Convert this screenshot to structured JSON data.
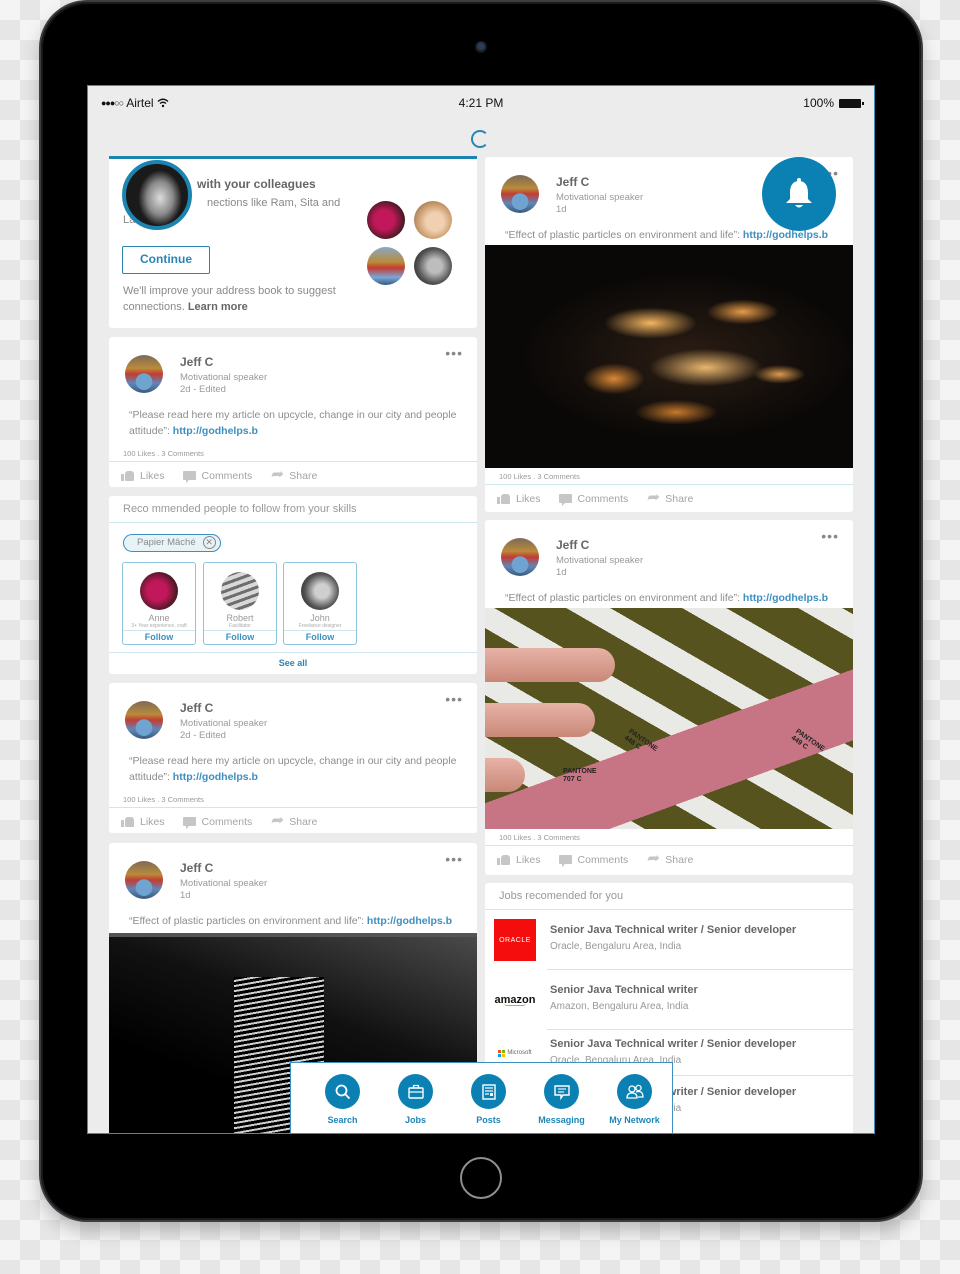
{
  "status_bar": {
    "carrier": "Airtel",
    "time": "4:21 PM",
    "battery": "100%"
  },
  "colors": {
    "accent": "#0b80b3",
    "link": "#3c8fc0",
    "background": "#ececec"
  },
  "connect_card": {
    "title": "Connect with your colleagues",
    "title_visible": "with your colleagues",
    "subtitle": "Find connections like Ram, Sita and La...",
    "subtitle_visible": "nections like Ram, Sita and La",
    "button_label": "Continue",
    "note": "We'll improve your address book to suggest connections.",
    "learn_more": "Learn more"
  },
  "people_card": {
    "header": "Jobs recomended for you / Recommended people to follow from your skills",
    "header_visible": "Reco mmended people to follow from your skills",
    "chip_label": "Papier Mâché",
    "people": [
      {
        "name": "Anne",
        "role": "3+ Year experience, craft",
        "follow": "Follow"
      },
      {
        "name": "Robert",
        "role": "Facilitator",
        "follow": "Follow"
      },
      {
        "name": "John",
        "role": "Freelance designer",
        "follow": "Follow"
      }
    ],
    "see_all": "See all"
  },
  "posts": [
    {
      "name": "Jeff C",
      "title": "Motivational speaker",
      "time": "2d - Edited",
      "text": "“Please read here my article on upcycle, change in our city and people attitude”: ",
      "link": "http://godhelps.b",
      "stats": "100  Likes . 3 Comments"
    },
    {
      "name": "Jeff C",
      "title": "Motivational speaker",
      "time": "2d - Edited",
      "text": "“Please read here my article on upcycle, change in our city and people attitude”: ",
      "link": "http://godhelps.b",
      "stats": "100  Likes . 3 Comments"
    },
    {
      "name": "Jeff C",
      "title": "Motivational speaker",
      "time": "1d",
      "text": "“Effect of plastic particles on environment and life”: ",
      "link": "http://godhelps.b"
    },
    {
      "name": "Jeff C",
      "title": "Motivational speaker",
      "time": "1d",
      "text": "“Effect of plastic particles on environment and life”: ",
      "link": "http://godhelps.b",
      "stats": "100  Likes . 3 Comments"
    },
    {
      "name": "Jeff C",
      "title": "Motivational speaker",
      "time": "1d",
      "text": "“Effect of plastic particles on environment and life”: ",
      "link": "http://godhelps.b",
      "stats": "100  Likes . 3 Comments"
    }
  ],
  "post_actions": {
    "likes": "Likes",
    "comments": "Comments",
    "share": "Share"
  },
  "pantone_labels": [
    "PANTONE 707 C",
    "PANTONE 448 C",
    "PANTONE 449 C"
  ],
  "jobs_card": {
    "header": "Jobs recomended for you",
    "jobs": [
      {
        "company_logo": "ORACLE",
        "title": "Senior Java Technical writer / Senior developer",
        "location": "Oracle, Bengaluru Area, India"
      },
      {
        "company_logo": "amazon",
        "title": "Senior Java Technical writer",
        "location": "Amazon, Bengaluru Area, India"
      },
      {
        "company_logo": "Microsoft",
        "title": "Senior Java Technical writer / Senior developer",
        "location": "Oracle, Bengaluru Area, India"
      },
      {
        "company_logo": "",
        "title": "Senior Java Technical writer / Senior developer",
        "location": "Oracle, Bengaluru Area, India"
      }
    ]
  },
  "bottom_nav": [
    {
      "label": "Search",
      "icon": "search-icon"
    },
    {
      "label": "Jobs",
      "icon": "briefcase-icon"
    },
    {
      "label": "Posts",
      "icon": "newspaper-icon"
    },
    {
      "label": "Messaging",
      "icon": "message-icon"
    },
    {
      "label": "My Network",
      "icon": "people-icon"
    }
  ]
}
